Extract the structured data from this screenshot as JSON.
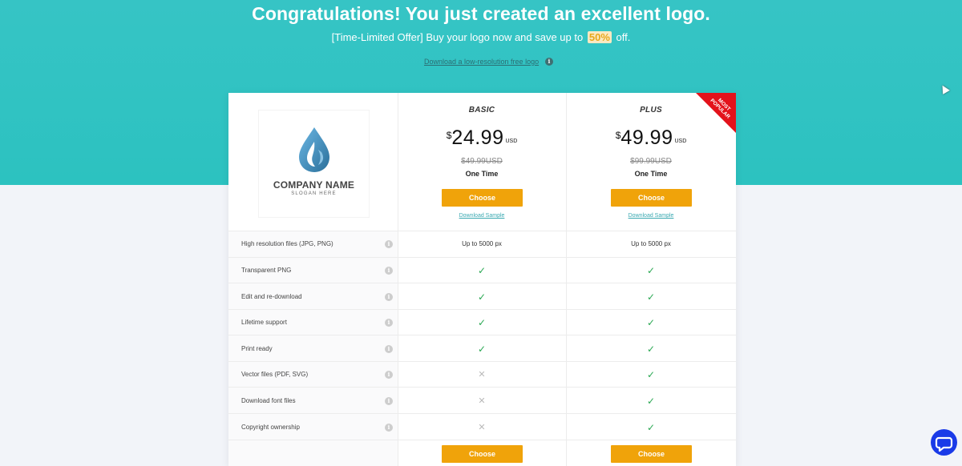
{
  "hero": {
    "title": "Congratulations! You just created an excellent logo.",
    "offer_prefix": "[Time-Limited Offer] Buy your logo now and save up to",
    "offer_percent": "50%",
    "offer_suffix": "off.",
    "download_free": "Download a low-resolution free logo"
  },
  "logo": {
    "company_name": "COMPANY NAME",
    "slogan": "SLOGAN HERE"
  },
  "plans": [
    {
      "name": "BASIC",
      "currency_symbol": "$",
      "price": "24.99",
      "currency": "USD",
      "old_price": "$49.99USD",
      "billing": "One Time",
      "choose_label": "Choose",
      "sample_label": "Download Sample"
    },
    {
      "name": "PLUS",
      "currency_symbol": "$",
      "price": "49.99",
      "currency": "USD",
      "old_price": "$99.99USD",
      "billing": "One Time",
      "choose_label": "Choose",
      "sample_label": "Download Sample",
      "ribbon": "MOST POPULAR"
    }
  ],
  "features": [
    {
      "label": "High resolution files (JPG, PNG)",
      "basic": "Up to 5000 px",
      "plus": "Up to 5000 px"
    },
    {
      "label": "Transparent PNG",
      "basic": "check",
      "plus": "check"
    },
    {
      "label": "Edit and re-download",
      "basic": "check",
      "plus": "check"
    },
    {
      "label": "Lifetime support",
      "basic": "check",
      "plus": "check"
    },
    {
      "label": "Print ready",
      "basic": "check",
      "plus": "check"
    },
    {
      "label": "Vector files (PDF, SVG)",
      "basic": "cross",
      "plus": "check"
    },
    {
      "label": "Download font files",
      "basic": "cross",
      "plus": "check"
    },
    {
      "label": "Copyright ownership",
      "basic": "cross",
      "plus": "check"
    }
  ],
  "footer_buttons": {
    "basic": "Choose",
    "plus": "Choose"
  },
  "colors": {
    "hero": "#2cc2c0",
    "button": "#f0a30a",
    "ribbon": "#e3121b",
    "check": "#2aa853",
    "chat": "#1a3ae8"
  },
  "icons": {
    "info": "info-icon",
    "check": "checkmark-icon",
    "cross": "cross-icon",
    "chat": "chat-bubble-icon",
    "logo": "water-drop-icon"
  }
}
